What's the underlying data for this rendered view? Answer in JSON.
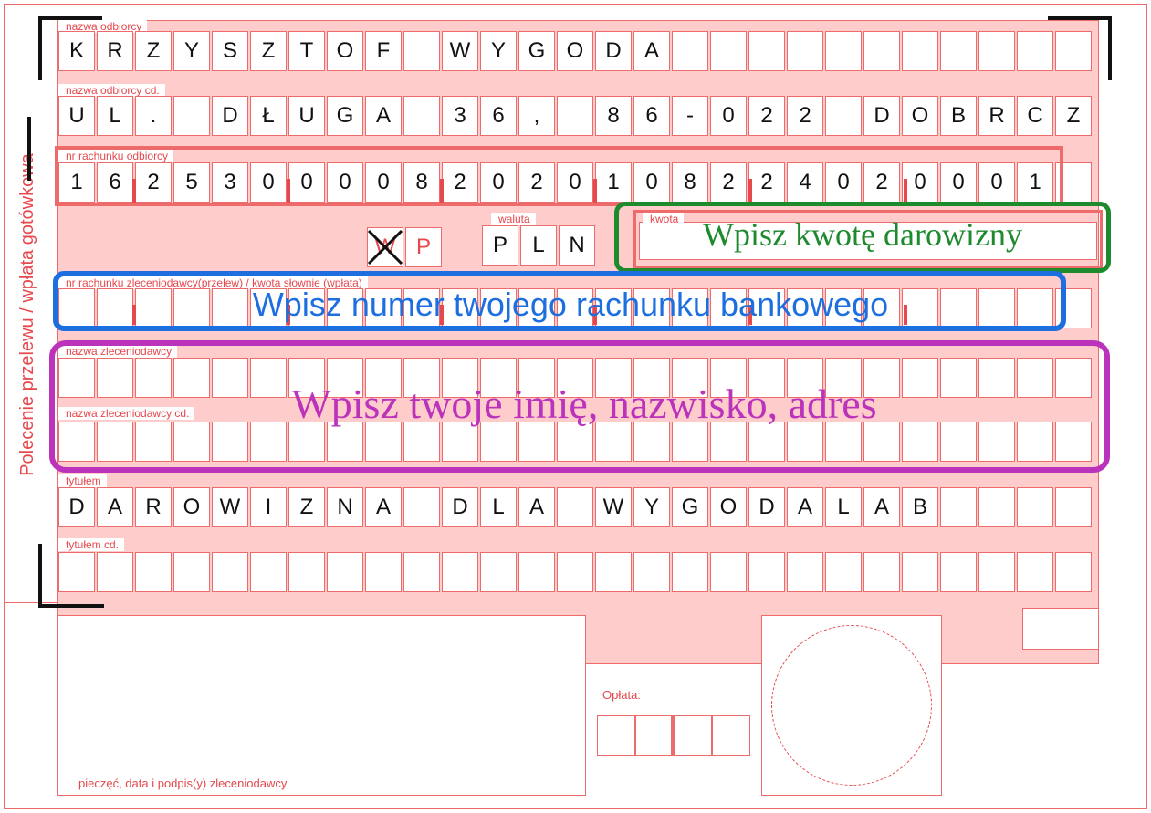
{
  "form": {
    "side_label": "Polecenie przelewu / wpłata gotówkowa",
    "rows": {
      "nazwa_odbiorcy": {
        "label": "nazwa odbiorcy",
        "text": "KRZYSZTOF WYGODA"
      },
      "nazwa_odbiorcy_cd": {
        "label": "nazwa odbiorcy cd.",
        "text": "UL. DŁUGA 36, 86-022 DOBRCZ"
      },
      "nr_rachunku": {
        "label": "nr rachunku odbiorcy",
        "text": "16253000082020108224020001"
      },
      "nr_rachunku_zleceniodawcy": {
        "label": "nr rachunku zleceniodawcy(przelew) / kwota słownie (wpłata)",
        "text": ""
      },
      "nazwa_zleceniodawcy": {
        "label": "nazwa zleceniodawcy",
        "text": ""
      },
      "nazwa_zleceniodawcy_cd": {
        "label": "nazwa zleceniodawcy cd.",
        "text": ""
      },
      "tytulem": {
        "label": "tytułem",
        "text": "DAROWIZNA DLA WYGODALAB"
      },
      "tytulem_cd": {
        "label": "tytułem cd.",
        "text": ""
      }
    },
    "type_boxes": [
      "W",
      "P"
    ],
    "waluta": {
      "label": "waluta",
      "value": "PLN"
    },
    "kwota": {
      "label": "kwota"
    },
    "oplata": {
      "label": "Opłata:"
    },
    "stamp_label": "pieczęć, data i podpis(y) zleceniodawcy"
  },
  "annotations": [
    {
      "text": "Wpisz kwotę darowizny",
      "color": "#1e8a2e"
    },
    {
      "text": "Wpisz numer twojego rachunku bankowego",
      "color": "#1d6fe0"
    },
    {
      "text": "Wpisz twoje imię, nazwisko, adres",
      "color": "#bb33bb"
    }
  ],
  "colors": {
    "form_bg": "#ffcccc",
    "form_line": "#ee6b6b",
    "label": "#e5484d"
  }
}
